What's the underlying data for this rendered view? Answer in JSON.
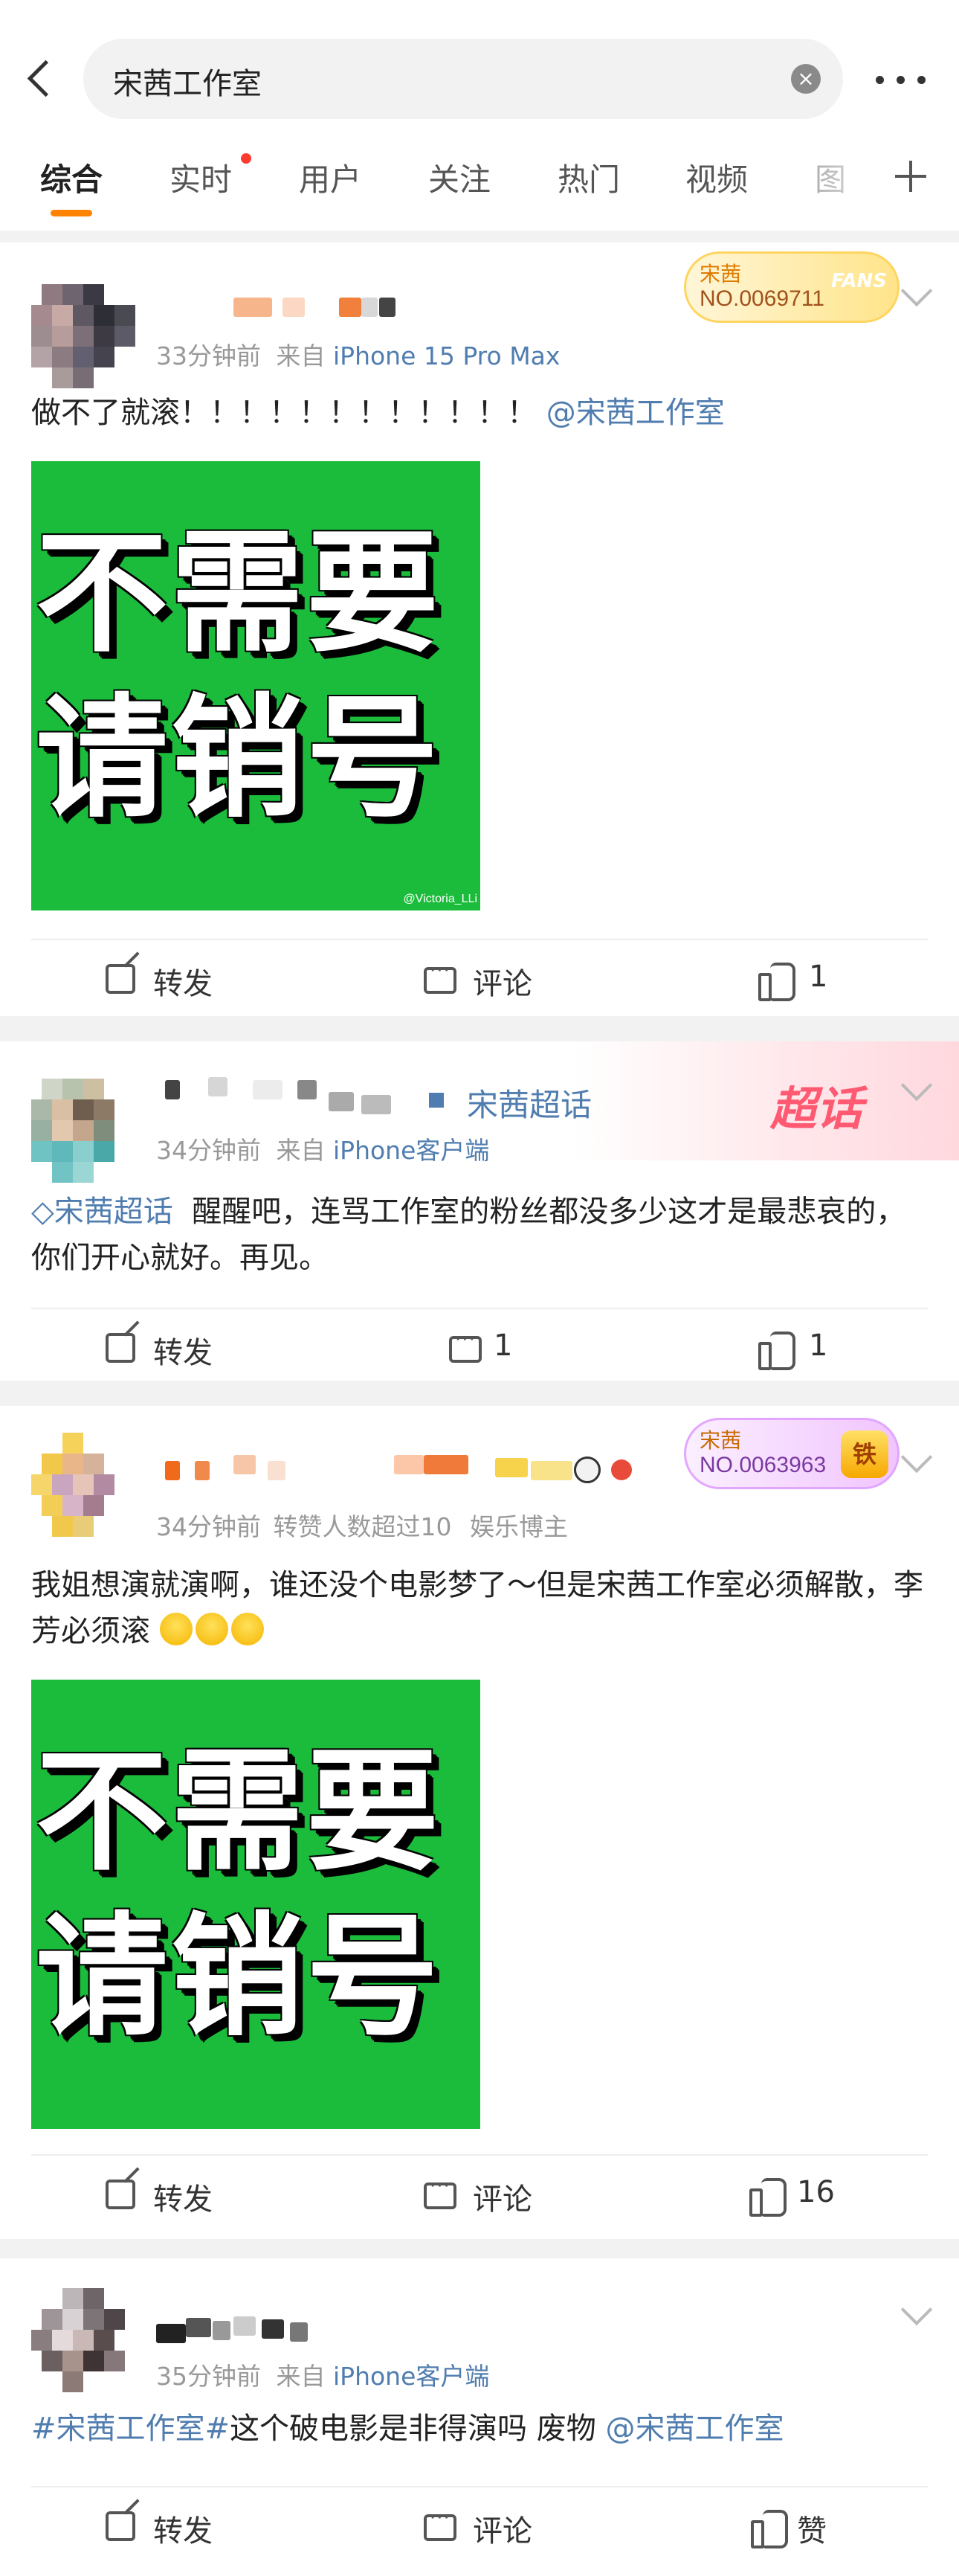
{
  "header": {
    "search_query": "宋茜工作室",
    "clear_icon": "clear-x-icon",
    "tabs": [
      "综合",
      "实时",
      "用户",
      "关注",
      "热门",
      "视频",
      "图"
    ]
  },
  "labels": {
    "repost": "转发",
    "comment": "评论"
  },
  "posts": [
    {
      "time": "33分钟前",
      "from_prefix": "来自",
      "source": "iPhone 15 Pro Max",
      "fans_badge": {
        "name": "宋茜",
        "number": "NO.0069711",
        "deco": "FANS"
      },
      "text_plain": "做不了就滚！！！！！！！！！！！！",
      "mention": "@宋茜工作室",
      "image": {
        "line1": "不需要",
        "line2": "请销号",
        "watermark": "@Victoria_LLi"
      },
      "actions": {
        "repost": "转发",
        "comment": "评论",
        "likes": "1"
      }
    },
    {
      "time": "34分钟前",
      "from_prefix": "来自",
      "source": "iPhone客户端",
      "chaohua_name": "宋茜超话",
      "chaohua_badge": "超话",
      "topic_tag": "宋茜超话",
      "text": "醒醒吧，连骂工作室的粉丝都没多少这才是最悲哀的，你们开心就好。再见。",
      "actions": {
        "repost": "转发",
        "comments": "1",
        "likes": "1"
      }
    },
    {
      "time": "34分钟前",
      "extra_meta": "转赞人数超过10",
      "role": "娱乐博主",
      "fans_badge": {
        "name": "宋茜",
        "number": "NO.0063963",
        "crown": "铁"
      },
      "text": "我姐想演就演啊，谁还没个电影梦了～但是宋茜工作室必须解散，李芳必须滚",
      "image": {
        "line1": "不需要",
        "line2": "请销号"
      },
      "actions": {
        "repost": "转发",
        "comment": "评论",
        "likes": "16"
      }
    },
    {
      "time": "35分钟前",
      "from_prefix": "来自",
      "source": "iPhone客户端",
      "hashtag": "#宋茜工作室#",
      "text": "这个破电影是非得演吗 废物",
      "mention": "@宋茜工作室",
      "actions": {
        "repost": "转发",
        "comment": "评论",
        "like": "赞"
      }
    }
  ],
  "colors": {
    "accent": "#ff8200",
    "link": "#507daf",
    "image_green": "#1bbc3b"
  }
}
